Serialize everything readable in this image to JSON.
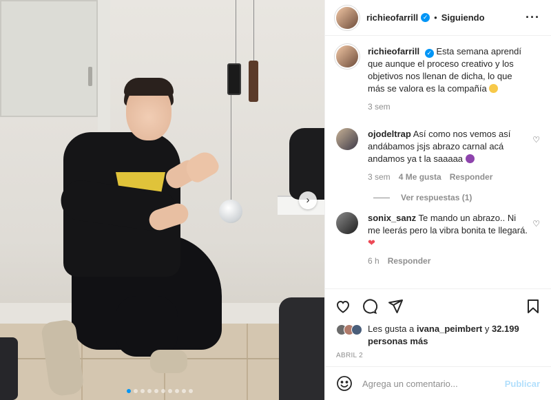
{
  "header": {
    "username": "richieofarrill",
    "verified_icon": "verified-badge-icon",
    "separator": "•",
    "follow_label": "Siguiendo",
    "more_icon": "more-options-icon"
  },
  "caption": {
    "username": "richieofarrill",
    "text": "Esta semana aprendí que aunque el proceso creativo y los objetivos nos llenan de dicha, lo que más se valora es la compañía",
    "time": "3 sem"
  },
  "comments": [
    {
      "username": "ojodeltrap",
      "text": "Así como nos vemos así andábamos jsjs abrazo carnal acá andamos ya t la saaaaa",
      "time": "3 sem",
      "likes": "4 Me gusta",
      "reply_label": "Responder",
      "view_replies": "Ver respuestas (1)"
    },
    {
      "username": "sonix_sanz",
      "text": "Te mando un abrazo.. Ni me leerás pero la vibra bonita te llegará.",
      "time": "6 h",
      "reply_label": "Responder"
    }
  ],
  "likes": {
    "prefix": "Les gusta a",
    "user": "ivana_peimbert",
    "middle": "y",
    "count": "32.199 personas más"
  },
  "date": "ABRIL 2",
  "add_comment": {
    "placeholder": "Agrega un comentario...",
    "publish_label": "Publicar"
  },
  "carousel": {
    "next_icon": "chevron-right-icon",
    "slide_count": 10,
    "active_slide": 1
  },
  "colors": {
    "accent": "#0095f6",
    "publish_disabled": "#b2dffc",
    "heart": "#ed4956"
  }
}
